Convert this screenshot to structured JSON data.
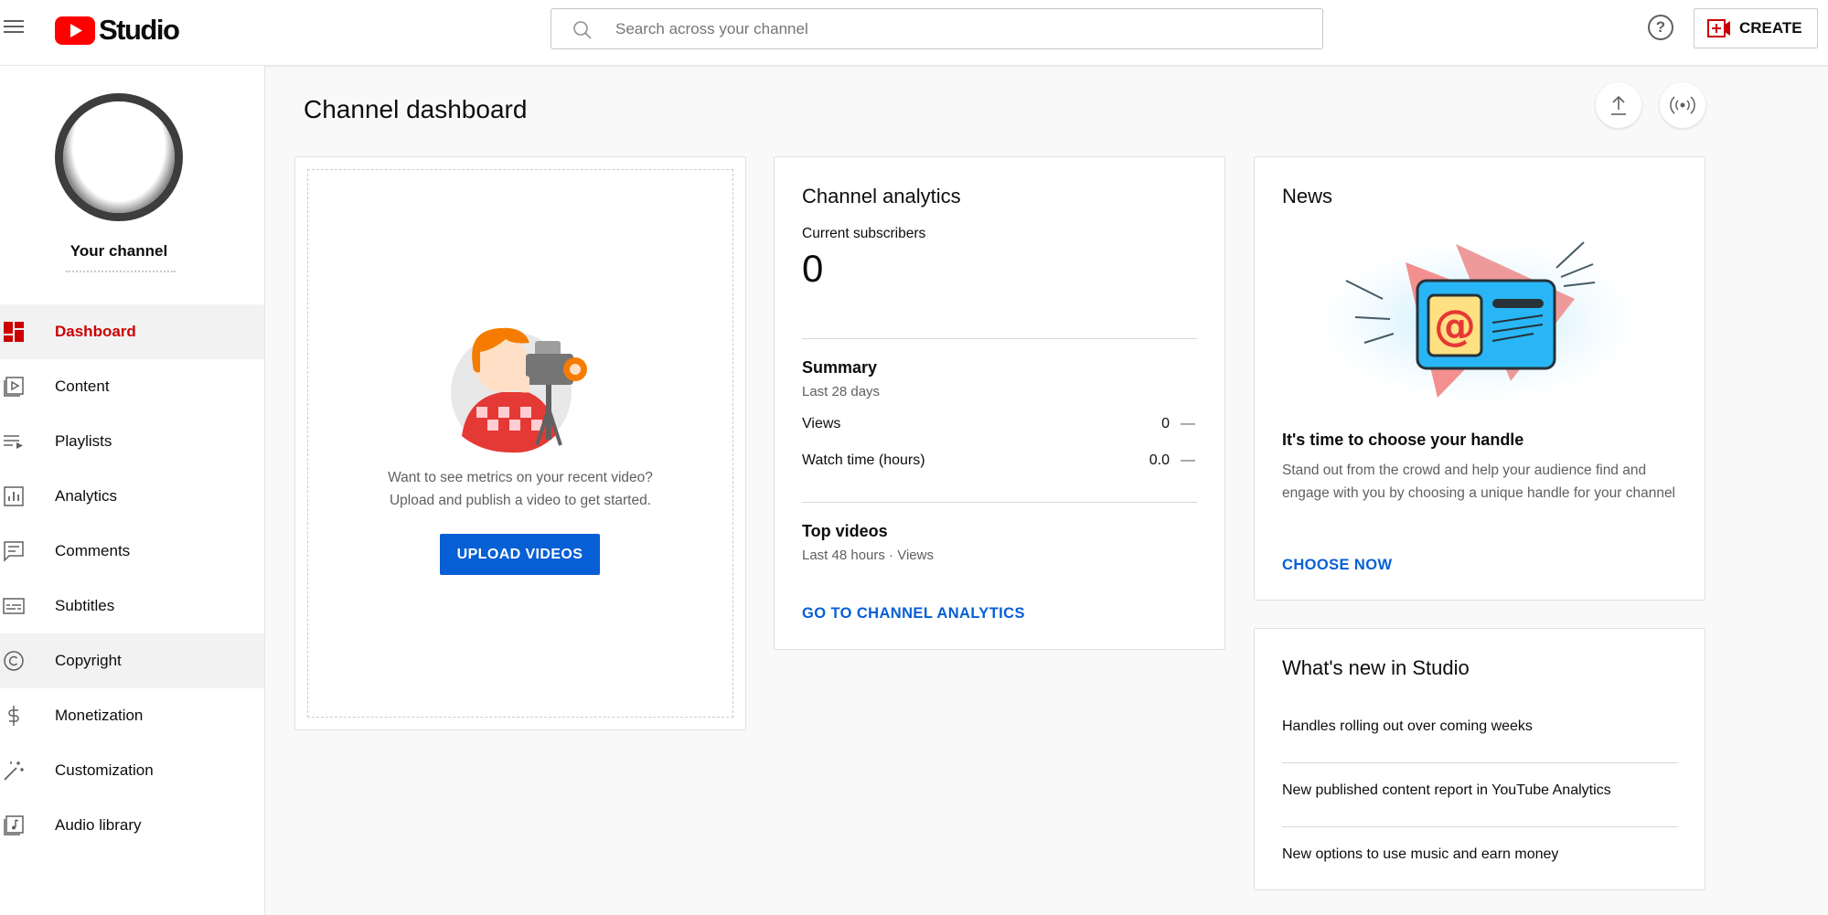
{
  "app": {
    "logo_text": "Studio",
    "brand_color": "#ff0000",
    "accent_color": "#065fd4"
  },
  "header": {
    "search_placeholder": "Search across your channel",
    "help_glyph": "?",
    "create_label": "CREATE"
  },
  "sidebar": {
    "channel_name": "Your channel",
    "items": [
      {
        "label": "Dashboard",
        "icon": "dashboard-icon",
        "active": true
      },
      {
        "label": "Content",
        "icon": "content-icon"
      },
      {
        "label": "Playlists",
        "icon": "playlists-icon"
      },
      {
        "label": "Analytics",
        "icon": "analytics-icon"
      },
      {
        "label": "Comments",
        "icon": "comments-icon"
      },
      {
        "label": "Subtitles",
        "icon": "subtitles-icon"
      },
      {
        "label": "Copyright",
        "icon": "copyright-icon",
        "hovered": true
      },
      {
        "label": "Monetization",
        "icon": "monetization-icon"
      },
      {
        "label": "Customization",
        "icon": "customization-icon"
      },
      {
        "label": "Audio library",
        "icon": "audio-library-icon"
      }
    ]
  },
  "main": {
    "page_title": "Channel dashboard",
    "upload_card": {
      "line1": "Want to see metrics on your recent video?",
      "line2": "Upload and publish a video to get started.",
      "button": "UPLOAD VIDEOS"
    },
    "analytics_card": {
      "title": "Channel analytics",
      "subscribers_label": "Current subscribers",
      "subscribers_value": "0",
      "summary_title": "Summary",
      "summary_period": "Last 28 days",
      "rows": [
        {
          "label": "Views",
          "value": "0",
          "trend": "—"
        },
        {
          "label": "Watch time (hours)",
          "value": "0.0",
          "trend": "—"
        }
      ],
      "top_videos_title": "Top videos",
      "top_videos_period": "Last 48 hours · Views",
      "link": "GO TO CHANNEL ANALYTICS"
    },
    "news_card": {
      "title": "News",
      "heading": "It's time to choose your handle",
      "body": "Stand out from the crowd and help your audience find and engage with you by choosing a unique handle for your channel",
      "link": "CHOOSE NOW"
    },
    "whats_new_card": {
      "title": "What's new in Studio",
      "items": [
        "Handles rolling out over coming weeks",
        "New published content report in YouTube Analytics",
        "New options to use music and earn money"
      ]
    }
  }
}
